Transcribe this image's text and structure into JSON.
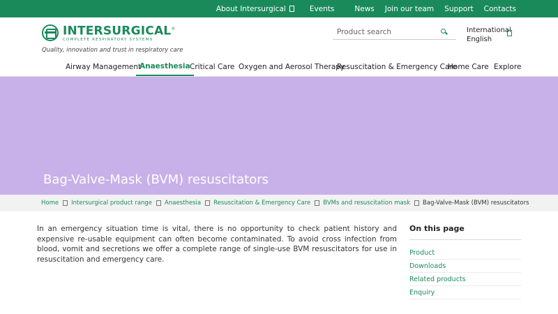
{
  "topbar": {
    "links": [
      "About Intersurgical",
      "Events",
      "News",
      "Join our team",
      "Support",
      "Contacts"
    ]
  },
  "brand": {
    "name": "INTERSURGICAL",
    "reg": "®",
    "subtitle": "COMPLETE RESPIRATORY SYSTEMS",
    "tagline": "Quality, innovation and trust in respiratory care",
    "color": "#1a8a5a"
  },
  "search": {
    "placeholder": "Product search"
  },
  "region": {
    "line1": "International",
    "line2": "English"
  },
  "nav": {
    "items": [
      "Airway Management",
      "Anaesthesia",
      "Critical Care",
      "Oxygen and Aerosol Therapy",
      "Resuscitation & Emergency Care",
      "Home Care",
      "Explore"
    ],
    "active": "Anaesthesia"
  },
  "hero": {
    "title": "Bag-Valve-Mask (BVM) resuscitators",
    "color": "#c8b0e8"
  },
  "breadcrumb": [
    "Home",
    "Intersurgical product range",
    "Anaesthesia",
    "Resuscitation & Emergency Care",
    "BVMs and resuscitation mask",
    "Bag-Valve-Mask (BVM) resuscitators"
  ],
  "content": {
    "intro": "In an emergency situation time is vital, there is no opportunity to check patient history and expensive re-usable equipment can often become contaminated. To avoid cross infection from blood, vomit and secretions we offer a complete range of single-use BVM resuscitators for use in resuscitation and emergency care."
  },
  "on_this_page": {
    "title": "On this page",
    "links": [
      "Product",
      "Downloads",
      "Related products",
      "Enquiry"
    ]
  }
}
